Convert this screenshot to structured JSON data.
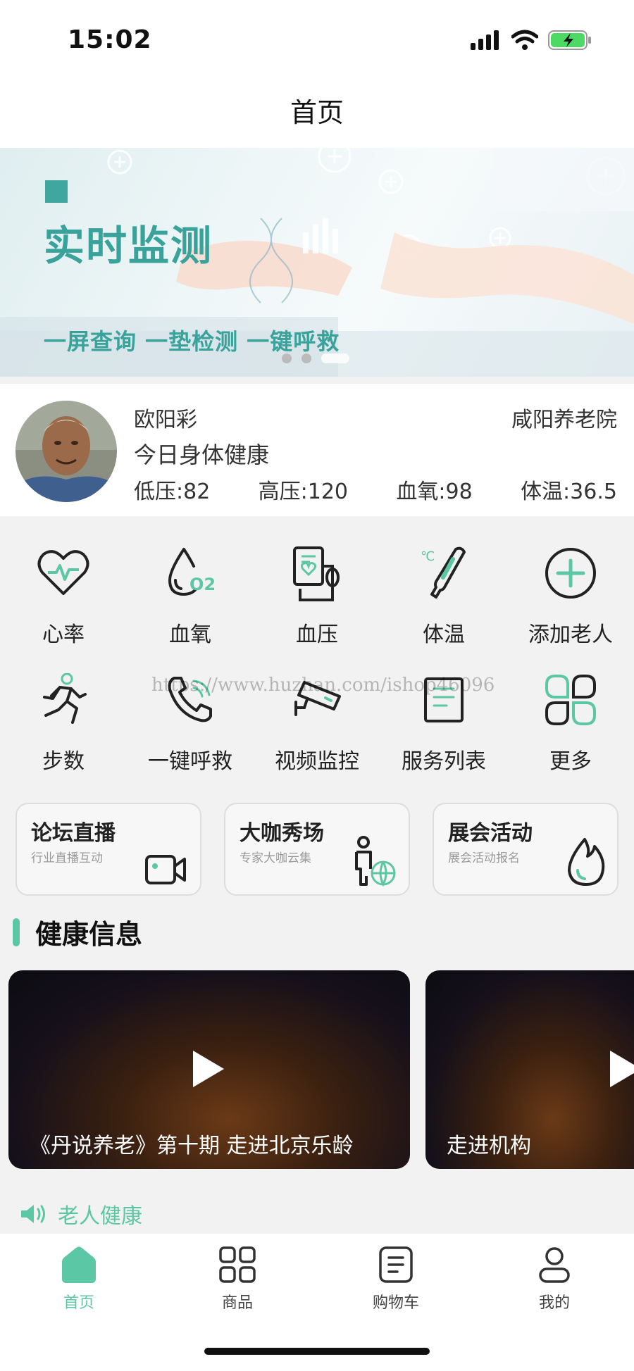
{
  "status_bar": {
    "time": "15:02"
  },
  "nav": {
    "title": "首页"
  },
  "banner": {
    "headline": "实时监测",
    "subline": "一屏查询 一垫检测 一键呼救"
  },
  "profile": {
    "name": "欧阳彩",
    "organization": "咸阳养老院",
    "health_status": "今日身体健康",
    "stats": [
      {
        "label": "低压:82"
      },
      {
        "label": "高压:120"
      },
      {
        "label": "血氧:98"
      },
      {
        "label": "体温:36.5"
      }
    ]
  },
  "grid": {
    "items": [
      {
        "label": "心率",
        "icon": "heart-rate-icon"
      },
      {
        "label": "血氧",
        "icon": "blood-oxygen-icon"
      },
      {
        "label": "血压",
        "icon": "blood-pressure-icon"
      },
      {
        "label": "体温",
        "icon": "thermometer-icon"
      },
      {
        "label": "添加老人",
        "icon": "add-circle-icon"
      },
      {
        "label": "步数",
        "icon": "running-icon"
      },
      {
        "label": "一键呼救",
        "icon": "phone-icon"
      },
      {
        "label": "视频监控",
        "icon": "camera-icon"
      },
      {
        "label": "服务列表",
        "icon": "list-icon"
      },
      {
        "label": "更多",
        "icon": "more-icon"
      }
    ]
  },
  "watermark": "https://www.huzhan.com/ishop46096",
  "cards": [
    {
      "title": "论坛直播",
      "subtitle": "行业直播互动",
      "icon": "video-camera-icon"
    },
    {
      "title": "大咖秀场",
      "subtitle": "专家大咖云集",
      "icon": "expert-globe-icon"
    },
    {
      "title": "展会活动",
      "subtitle": "展会活动报名",
      "icon": "flame-icon"
    }
  ],
  "section": {
    "title": "健康信息"
  },
  "videos": [
    {
      "title": "《丹说养老》第十期 走进北京乐龄"
    },
    {
      "title": "走进机构"
    }
  ],
  "notice": {
    "text": "老人健康"
  },
  "tabbar": {
    "tabs": [
      {
        "label": "首页",
        "icon": "home-icon",
        "active": true
      },
      {
        "label": "商品",
        "icon": "grid-icon",
        "active": false
      },
      {
        "label": "购物车",
        "icon": "cart-list-icon",
        "active": false
      },
      {
        "label": "我的",
        "icon": "user-icon",
        "active": false
      }
    ]
  },
  "colors": {
    "accent": "#5cc7a4",
    "banner_teal": "#38a29b"
  }
}
